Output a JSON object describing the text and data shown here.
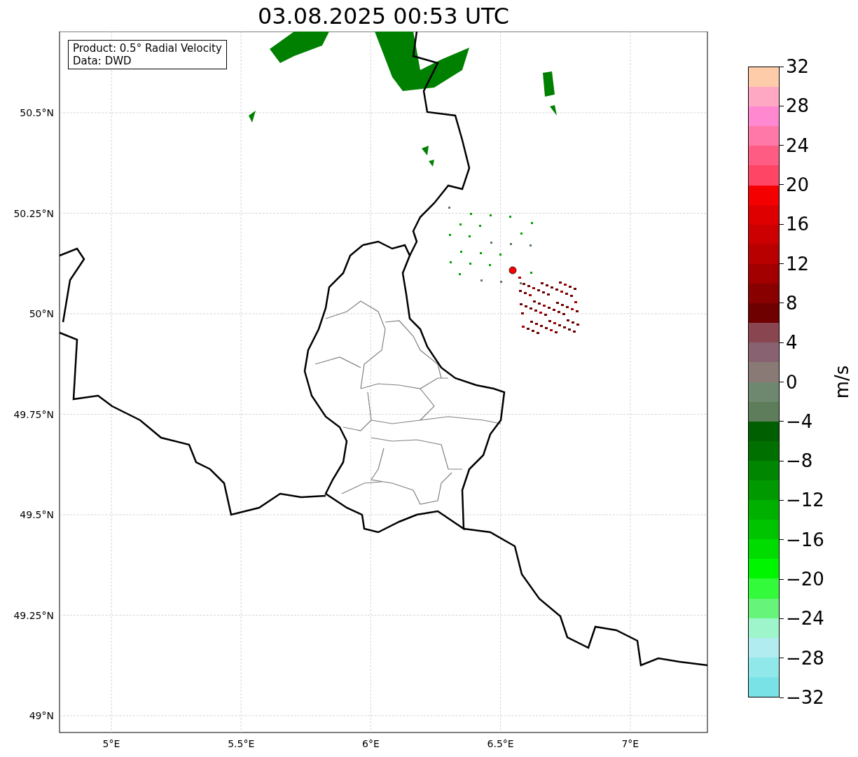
{
  "title": "03.08.2025 00:53 UTC",
  "info_box": {
    "lines": [
      "Product: 0.5° Radial Velocity",
      "Data: DWD"
    ]
  },
  "map": {
    "lat_ticks": [
      "50.5°N",
      "50.25°N",
      "50°N",
      "49.75°N",
      "49.5°N",
      "49.25°N",
      "49°N"
    ],
    "lon_ticks": [
      "5°E",
      "5.5°E",
      "6°E",
      "6.5°E",
      "7°E"
    ]
  },
  "colorbar": {
    "label": "m/s",
    "ticks": [
      "32",
      "28",
      "24",
      "20",
      "16",
      "12",
      "8",
      "4",
      "0",
      "−4",
      "−8",
      "−12",
      "−16",
      "−20",
      "−24",
      "−28",
      "−32"
    ],
    "segments": [
      {
        "color": "#ffccaa"
      },
      {
        "color": "#ffa8c4"
      },
      {
        "color": "#ff88d0"
      },
      {
        "color": "#ff78a8"
      },
      {
        "color": "#ff5c84"
      },
      {
        "color": "#ff4566"
      },
      {
        "color": "#f50000"
      },
      {
        "color": "#de0000"
      },
      {
        "color": "#cc0000"
      },
      {
        "color": "#b80000"
      },
      {
        "color": "#a20000"
      },
      {
        "color": "#880000"
      },
      {
        "color": "#6e0000"
      },
      {
        "color": "#8a4650"
      },
      {
        "color": "#886270"
      },
      {
        "color": "#8a7a76"
      },
      {
        "color": "#6e8870"
      },
      {
        "color": "#5e7d5a"
      },
      {
        "color": "#005f00"
      },
      {
        "color": "#007000"
      },
      {
        "color": "#008600"
      },
      {
        "color": "#009a00"
      },
      {
        "color": "#00b000"
      },
      {
        "color": "#00c400"
      },
      {
        "color": "#00dc00"
      },
      {
        "color": "#00f500"
      },
      {
        "color": "#33fb3b"
      },
      {
        "color": "#66f57a"
      },
      {
        "color": "#9ef5cc"
      },
      {
        "color": "#b0ecf0"
      },
      {
        "color": "#90e8ea"
      },
      {
        "color": "#78e2e6"
      }
    ]
  }
}
